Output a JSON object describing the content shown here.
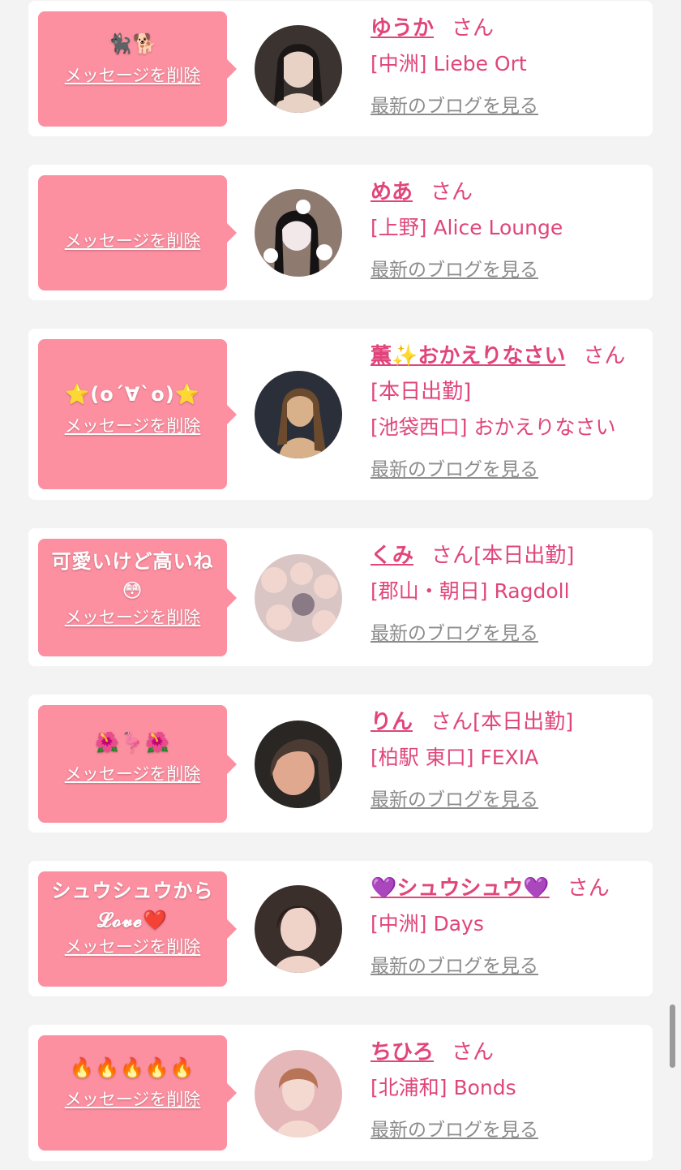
{
  "delete_label": "メッセージを削除",
  "blog_label": "最新のブログを見る",
  "san_label": "さん",
  "colors": {
    "bubble": "#fc8fa0",
    "accent": "#e0457b",
    "link_gray": "#8c8c8c",
    "background": "#f3f3f3"
  },
  "cards": [
    {
      "message": "🐈‍⬛🐕",
      "name": "ゆうか",
      "status": "",
      "shop": "[中洲] Liebe Ort",
      "avatar_colors": [
        "#3a3330",
        "#e8d2c6",
        "#1b1716"
      ]
    },
    {
      "message": "",
      "name": "めあ",
      "status": "",
      "shop": "[上野] Alice Lounge",
      "avatar_colors": [
        "#8f7a70",
        "#f2e8ea",
        "#151213"
      ]
    },
    {
      "message": "⭐️(o´∀`o)⭐️",
      "name": "薫✨おかえりなさい",
      "status": "[本日出勤]",
      "shop": "[池袋西口] おかえりなさい",
      "avatar_colors": [
        "#2a2f3a",
        "#d8b08a",
        "#6b4a2e"
      ]
    },
    {
      "message": "可愛いけど高いね😳",
      "name": "くみ",
      "status": "[本日出勤]",
      "shop": "[郡山・朝日] Ragdoll",
      "avatar_colors": [
        "#d9c6c4",
        "#f1d6cf",
        "#8a7a86"
      ]
    },
    {
      "message": "🌺🦩🌺",
      "name": "りん",
      "status": "[本日出勤]",
      "shop": "[柏駅 東口] FEXIA",
      "avatar_colors": [
        "#2a2624",
        "#e0a98f",
        "#4b3b33"
      ]
    },
    {
      "message": "シュウシュウから𝓛𝓸𝓿𝓮❤️",
      "name": "💜シュウシュウ💜",
      "status": "",
      "shop": "[中洲] Days",
      "avatar_colors": [
        "#3b2f2c",
        "#f0d3c8",
        "#2b1e1c"
      ]
    },
    {
      "message": "🔥🔥🔥🔥🔥",
      "name": "ちひろ",
      "status": "",
      "shop": "[北浦和] Bonds",
      "avatar_colors": [
        "#e5b7b9",
        "#f3d9cf",
        "#b77456"
      ]
    }
  ]
}
